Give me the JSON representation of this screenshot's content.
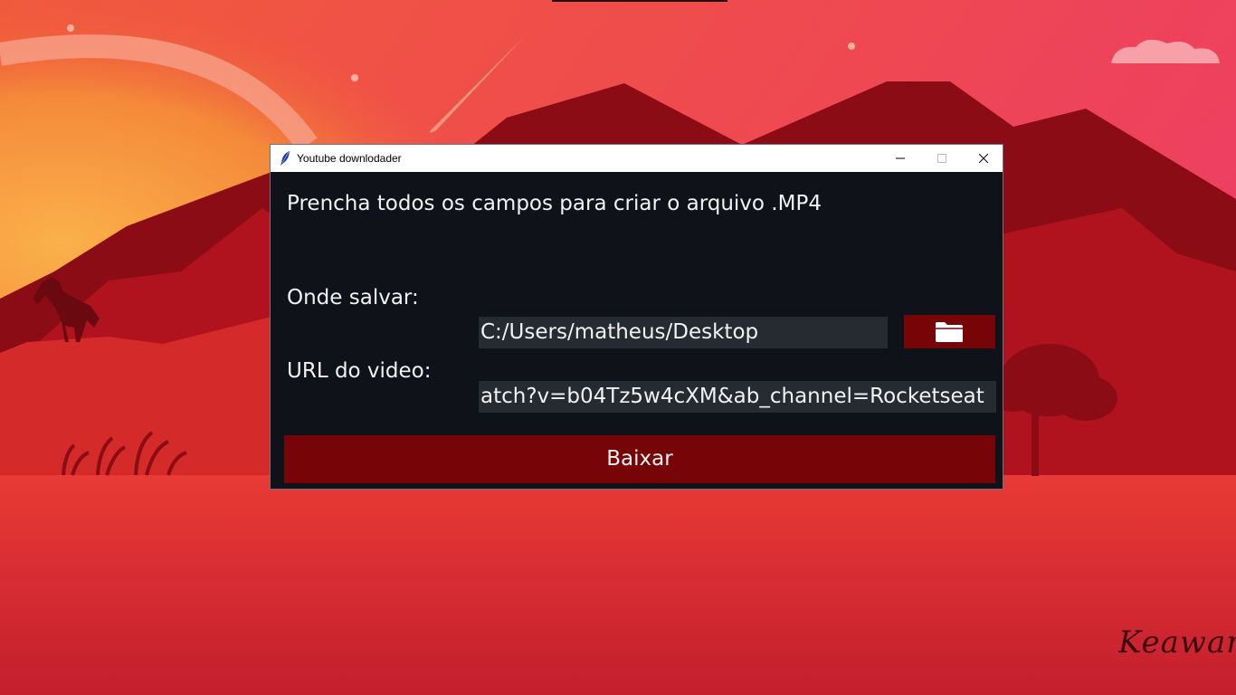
{
  "window": {
    "title": "Youtube downlodader",
    "heading": "Prencha todos os  campos para criar o arquivo .MP4"
  },
  "form": {
    "save_label": "Onde salvar:",
    "save_path": "C:/Users/matheus/Desktop",
    "url_label": "URL do video:",
    "url_value": "atch?v=b04Tz5w4cXM&ab_channel=Rocketseat",
    "download_label": "Baixar",
    "folder_icon": "folder-icon"
  },
  "desktop": {
    "signature": "Keawan. A"
  },
  "colors": {
    "window_bg": "#0f1218",
    "field_bg": "#262a31",
    "button_bg": "#770508",
    "text": "#f2f2f2"
  }
}
